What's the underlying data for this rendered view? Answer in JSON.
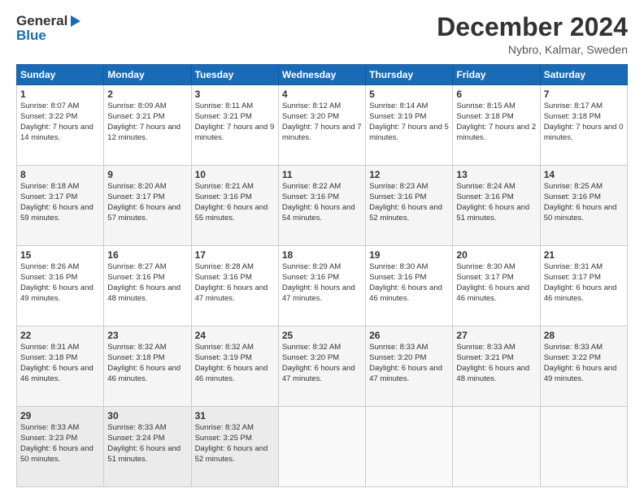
{
  "logo": {
    "line1": "General",
    "line2": "Blue"
  },
  "title": "December 2024",
  "subtitle": "Nybro, Kalmar, Sweden",
  "days_of_week": [
    "Sunday",
    "Monday",
    "Tuesday",
    "Wednesday",
    "Thursday",
    "Friday",
    "Saturday"
  ],
  "weeks": [
    [
      {
        "day": 1,
        "sunrise": "8:07 AM",
        "sunset": "3:22 PM",
        "daylight": "7 hours and 14 minutes."
      },
      {
        "day": 2,
        "sunrise": "8:09 AM",
        "sunset": "3:21 PM",
        "daylight": "7 hours and 12 minutes."
      },
      {
        "day": 3,
        "sunrise": "8:11 AM",
        "sunset": "3:21 PM",
        "daylight": "7 hours and 9 minutes."
      },
      {
        "day": 4,
        "sunrise": "8:12 AM",
        "sunset": "3:20 PM",
        "daylight": "7 hours and 7 minutes."
      },
      {
        "day": 5,
        "sunrise": "8:14 AM",
        "sunset": "3:19 PM",
        "daylight": "7 hours and 5 minutes."
      },
      {
        "day": 6,
        "sunrise": "8:15 AM",
        "sunset": "3:18 PM",
        "daylight": "7 hours and 2 minutes."
      },
      {
        "day": 7,
        "sunrise": "8:17 AM",
        "sunset": "3:18 PM",
        "daylight": "7 hours and 0 minutes."
      }
    ],
    [
      {
        "day": 8,
        "sunrise": "8:18 AM",
        "sunset": "3:17 PM",
        "daylight": "6 hours and 59 minutes."
      },
      {
        "day": 9,
        "sunrise": "8:20 AM",
        "sunset": "3:17 PM",
        "daylight": "6 hours and 57 minutes."
      },
      {
        "day": 10,
        "sunrise": "8:21 AM",
        "sunset": "3:16 PM",
        "daylight": "6 hours and 55 minutes."
      },
      {
        "day": 11,
        "sunrise": "8:22 AM",
        "sunset": "3:16 PM",
        "daylight": "6 hours and 54 minutes."
      },
      {
        "day": 12,
        "sunrise": "8:23 AM",
        "sunset": "3:16 PM",
        "daylight": "6 hours and 52 minutes."
      },
      {
        "day": 13,
        "sunrise": "8:24 AM",
        "sunset": "3:16 PM",
        "daylight": "6 hours and 51 minutes."
      },
      {
        "day": 14,
        "sunrise": "8:25 AM",
        "sunset": "3:16 PM",
        "daylight": "6 hours and 50 minutes."
      }
    ],
    [
      {
        "day": 15,
        "sunrise": "8:26 AM",
        "sunset": "3:16 PM",
        "daylight": "6 hours and 49 minutes."
      },
      {
        "day": 16,
        "sunrise": "8:27 AM",
        "sunset": "3:16 PM",
        "daylight": "6 hours and 48 minutes."
      },
      {
        "day": 17,
        "sunrise": "8:28 AM",
        "sunset": "3:16 PM",
        "daylight": "6 hours and 47 minutes."
      },
      {
        "day": 18,
        "sunrise": "8:29 AM",
        "sunset": "3:16 PM",
        "daylight": "6 hours and 47 minutes."
      },
      {
        "day": 19,
        "sunrise": "8:30 AM",
        "sunset": "3:16 PM",
        "daylight": "6 hours and 46 minutes."
      },
      {
        "day": 20,
        "sunrise": "8:30 AM",
        "sunset": "3:17 PM",
        "daylight": "6 hours and 46 minutes."
      },
      {
        "day": 21,
        "sunrise": "8:31 AM",
        "sunset": "3:17 PM",
        "daylight": "6 hours and 46 minutes."
      }
    ],
    [
      {
        "day": 22,
        "sunrise": "8:31 AM",
        "sunset": "3:18 PM",
        "daylight": "6 hours and 46 minutes."
      },
      {
        "day": 23,
        "sunrise": "8:32 AM",
        "sunset": "3:18 PM",
        "daylight": "6 hours and 46 minutes."
      },
      {
        "day": 24,
        "sunrise": "8:32 AM",
        "sunset": "3:19 PM",
        "daylight": "6 hours and 46 minutes."
      },
      {
        "day": 25,
        "sunrise": "8:32 AM",
        "sunset": "3:20 PM",
        "daylight": "6 hours and 47 minutes."
      },
      {
        "day": 26,
        "sunrise": "8:33 AM",
        "sunset": "3:20 PM",
        "daylight": "6 hours and 47 minutes."
      },
      {
        "day": 27,
        "sunrise": "8:33 AM",
        "sunset": "3:21 PM",
        "daylight": "6 hours and 48 minutes."
      },
      {
        "day": 28,
        "sunrise": "8:33 AM",
        "sunset": "3:22 PM",
        "daylight": "6 hours and 49 minutes."
      }
    ],
    [
      {
        "day": 29,
        "sunrise": "8:33 AM",
        "sunset": "3:23 PM",
        "daylight": "6 hours and 50 minutes."
      },
      {
        "day": 30,
        "sunrise": "8:33 AM",
        "sunset": "3:24 PM",
        "daylight": "6 hours and 51 minutes."
      },
      {
        "day": 31,
        "sunrise": "8:32 AM",
        "sunset": "3:25 PM",
        "daylight": "6 hours and 52 minutes."
      },
      null,
      null,
      null,
      null
    ]
  ]
}
